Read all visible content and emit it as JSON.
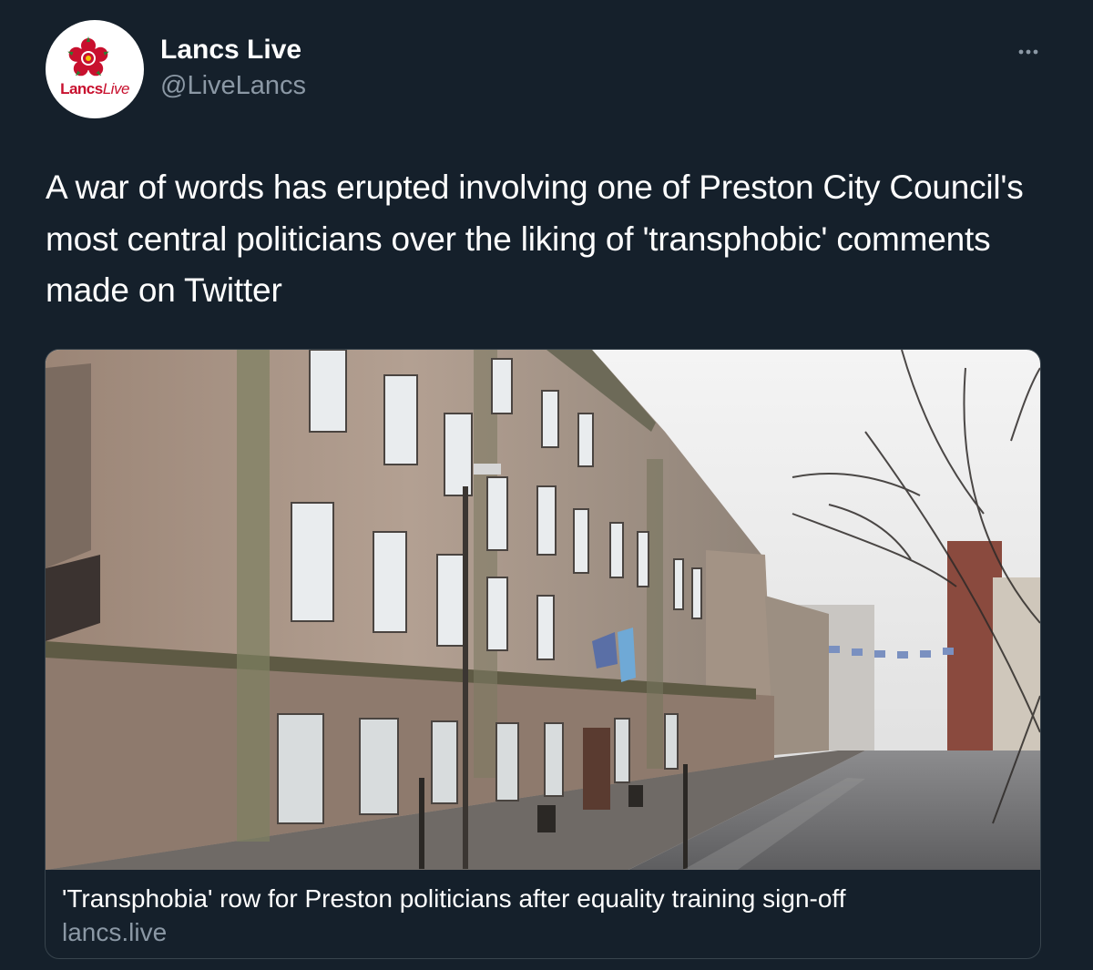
{
  "tweet": {
    "author": {
      "display_name": "Lancs Live",
      "handle": "@LiveLancs",
      "avatar": {
        "logo_text_part1": "Lancs",
        "logo_text_part2": "Live",
        "icon": "red-rose-icon"
      }
    },
    "more_icon": "more-horizontal-icon",
    "text": "A war of words has erupted involving one of Preston City Council's most central politicians over the liking of 'transphobic' comments made on Twitter",
    "link_card": {
      "image_icon": "building-photo",
      "title": "'Transphobia' row for Preston politicians after equality training sign-off",
      "domain": "lancs.live"
    }
  },
  "colors": {
    "background": "#15202b",
    "text_primary": "#ffffff",
    "text_secondary": "#8b98a5",
    "card_border": "#38444d",
    "logo_red": "#c8102e"
  }
}
